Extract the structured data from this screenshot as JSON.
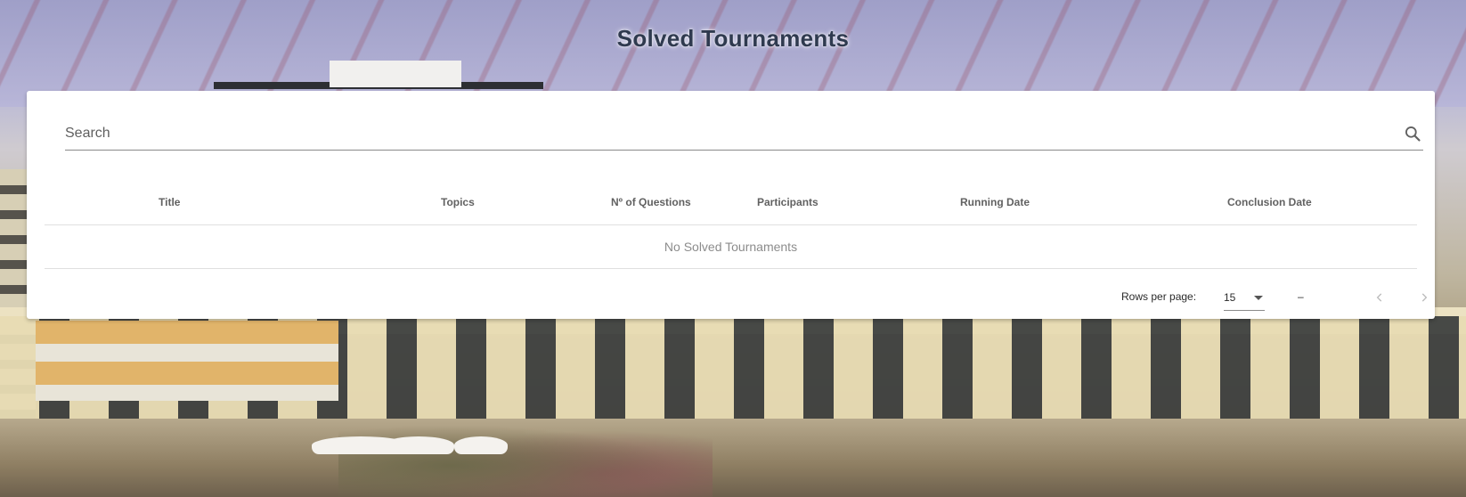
{
  "page": {
    "title": "Solved Tournaments"
  },
  "search": {
    "placeholder": "Search",
    "value": "",
    "icon": "search-icon"
  },
  "table": {
    "columns": [
      "Title",
      "Topics",
      "Nº of Questions",
      "Participants",
      "Running Date",
      "Conclusion Date"
    ],
    "rows": [],
    "empty_text": "No Solved Tournaments"
  },
  "pagination": {
    "rows_per_page_label": "Rows per page:",
    "rows_per_page_value": "15",
    "range_text": "–",
    "prev_icon": "chevron-left-icon",
    "next_icon": "chevron-right-icon"
  },
  "colors": {
    "title_text": "#2f3a4f",
    "card_bg": "#ffffff",
    "header_text": "#616161",
    "empty_text": "#8c8c8c",
    "disabled_icon": "#bdbdbd"
  }
}
